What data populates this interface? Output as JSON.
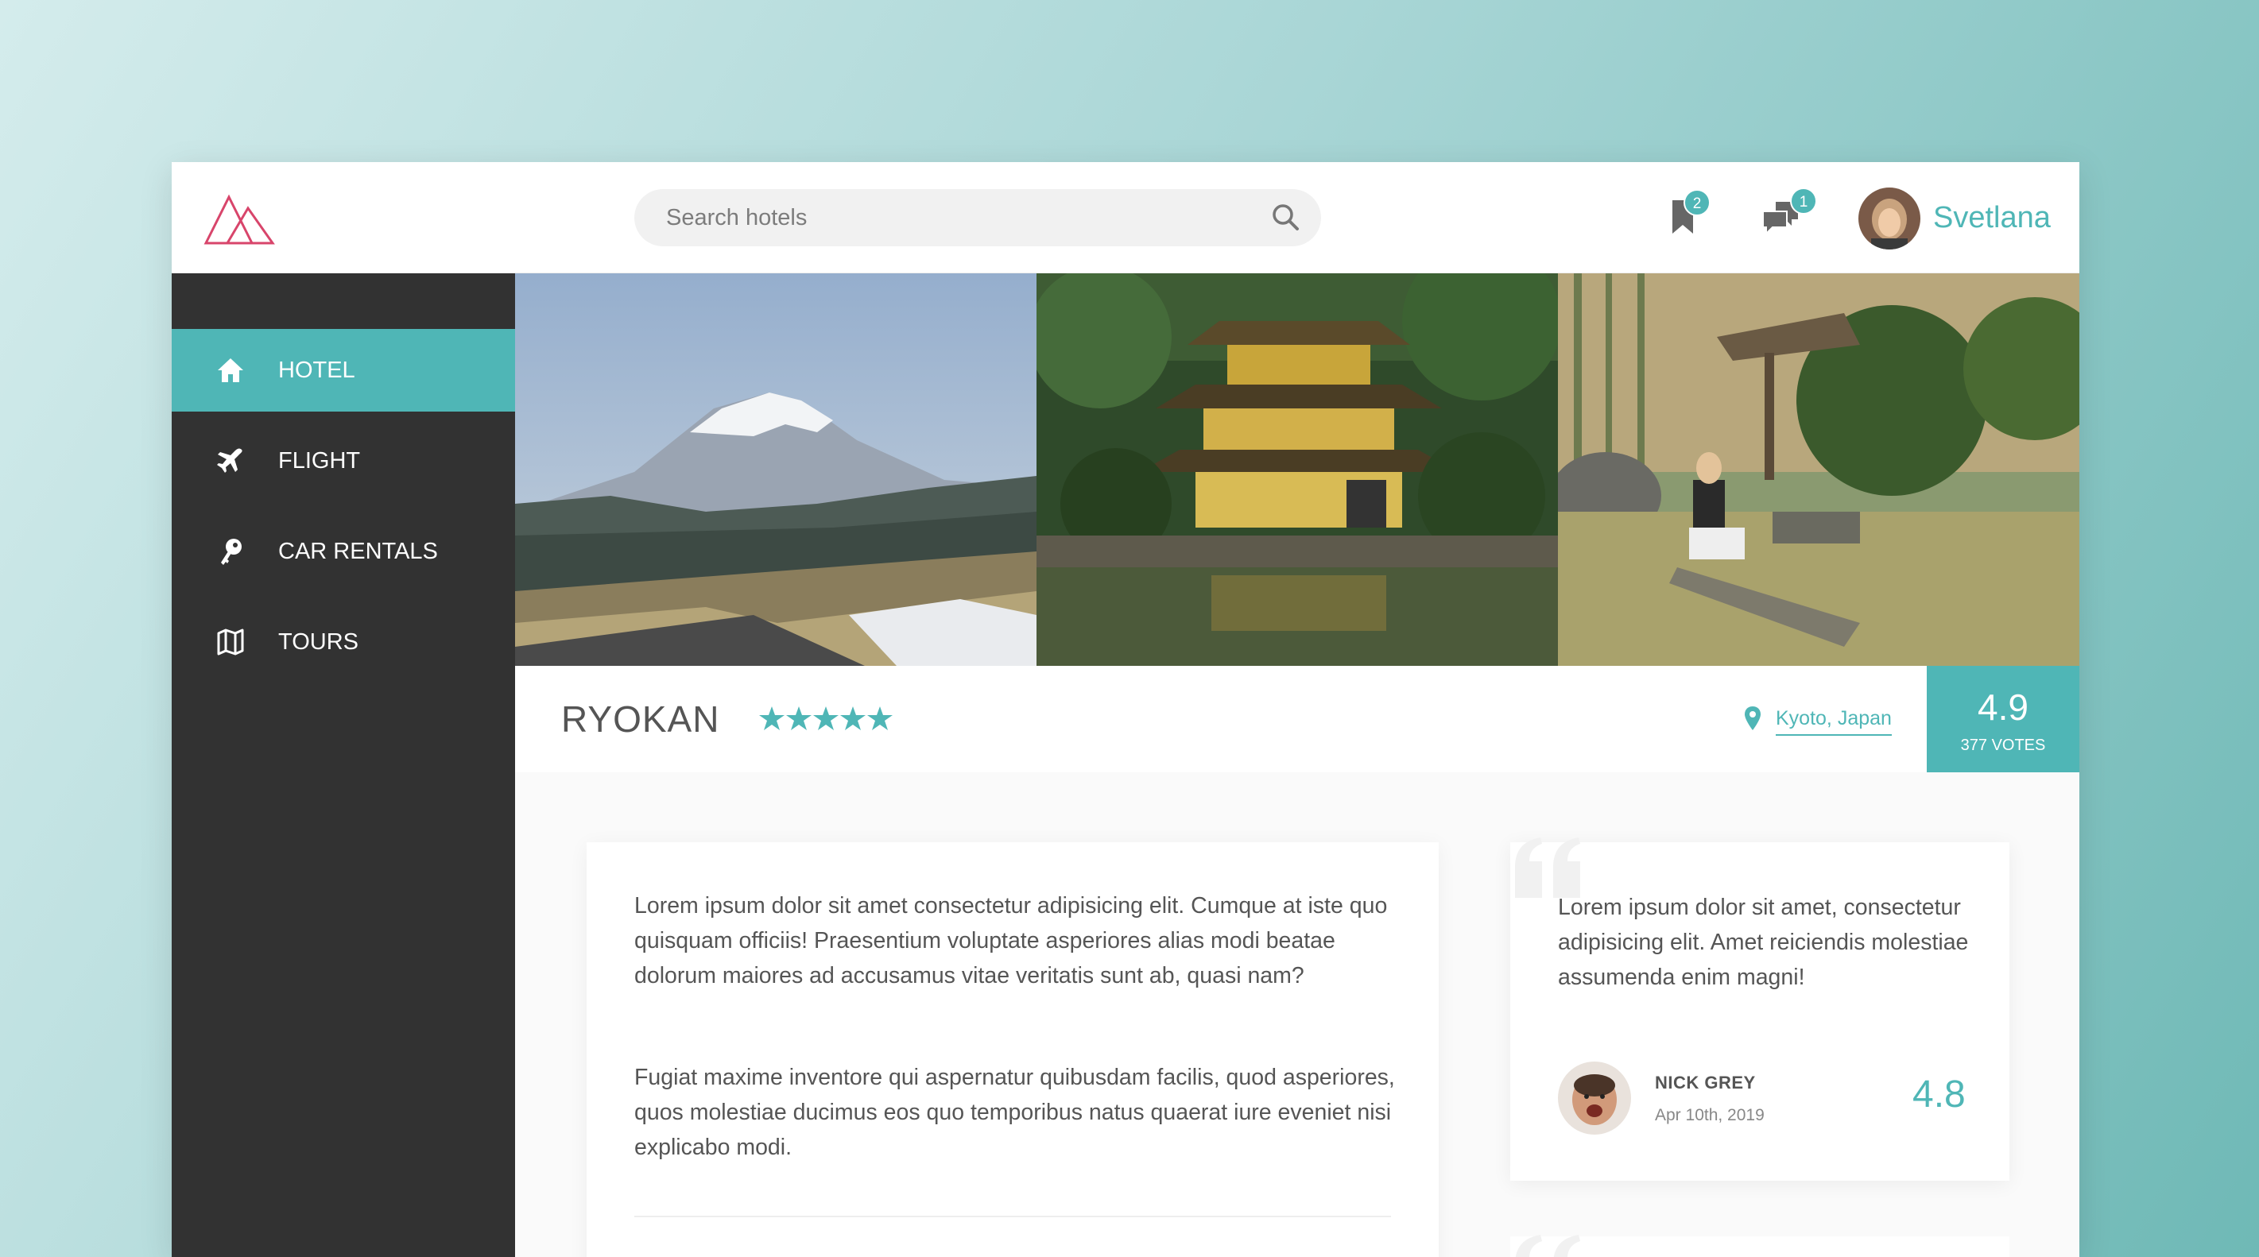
{
  "header": {
    "search_placeholder": "Search hotels",
    "bookmarks_count": "2",
    "messages_count": "1",
    "user_name": "Svetlana"
  },
  "sidebar": {
    "items": [
      {
        "label": "HOTEL",
        "icon": "home-icon",
        "active": true
      },
      {
        "label": "FLIGHT",
        "icon": "plane-icon",
        "active": false
      },
      {
        "label": "CAR RENTALS",
        "icon": "key-icon",
        "active": false
      },
      {
        "label": "TOURS",
        "icon": "map-icon",
        "active": false
      }
    ]
  },
  "gallery": {
    "photos": [
      "mount-fuji-photo",
      "golden-pavilion-photo",
      "garden-photo"
    ]
  },
  "hotel": {
    "name": "RYOKAN",
    "stars": 5,
    "location": "Kyoto, Japan",
    "rating": "4.9",
    "votes": "377 VOTES"
  },
  "description": {
    "paragraph1": "Lorem ipsum dolor sit amet consectetur adipisicing elit. Cumque at iste quo quisquam officiis! Praesentium voluptate asperiores alias modi beatae dolorum maiores ad accusamus vitae veritatis sunt ab, quasi nam?",
    "paragraph2": "Fugiat maxime inventore qui aspernatur quibusdam facilis, quod asperiores, quos molestiae ducimus eos quo temporibus natus quaerat iure eveniet nisi explicabo modi."
  },
  "review": {
    "text": "Lorem ipsum dolor sit amet, consectetur adipisicing elit. Amet reiciendis molestiae assumenda enim magni!",
    "author": "NICK GREY",
    "date": "Apr 10th, 2019",
    "score": "4.8"
  },
  "colors": {
    "accent": "#4fb6b6",
    "logo": "#d8456b",
    "sidebar": "#323232"
  }
}
